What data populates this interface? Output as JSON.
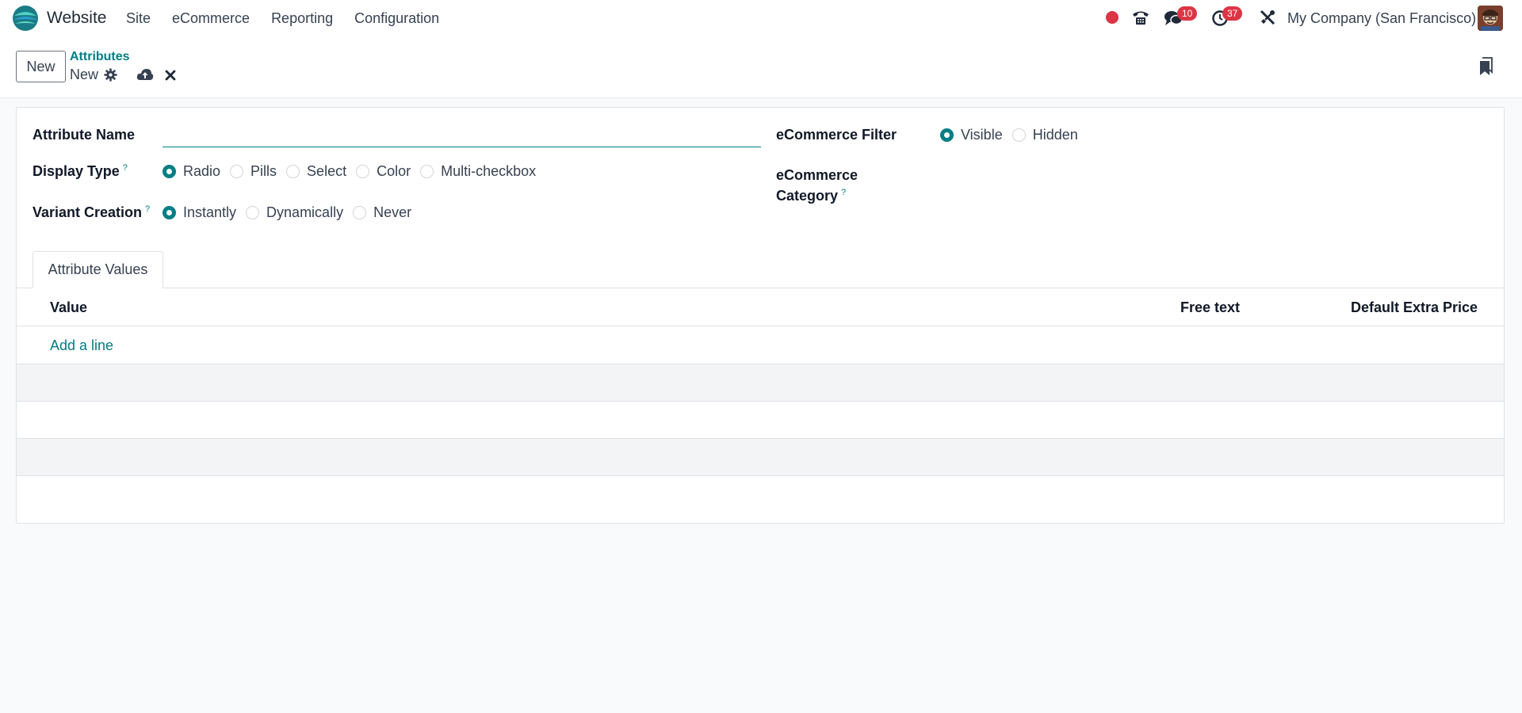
{
  "navbar": {
    "app_name": "Website",
    "menu": [
      "Site",
      "eCommerce",
      "Reporting",
      "Configuration"
    ],
    "messages_count": "10",
    "activities_count": "37",
    "company": "My Company (San Francisco)"
  },
  "control": {
    "new_button": "New",
    "breadcrumb_parent": "Attributes",
    "breadcrumb_current": "New"
  },
  "form": {
    "attribute_name_label": "Attribute Name",
    "attribute_name_value": "",
    "display_type_label": "Display Type",
    "display_type_help": "?",
    "display_type_options": [
      "Radio",
      "Pills",
      "Select",
      "Color",
      "Multi-checkbox"
    ],
    "display_type_selected": "Radio",
    "variant_creation_label": "Variant Creation",
    "variant_creation_help": "?",
    "variant_creation_options": [
      "Instantly",
      "Dynamically",
      "Never"
    ],
    "variant_creation_selected": "Instantly",
    "ecommerce_filter_label": "eCommerce Filter",
    "ecommerce_filter_options": [
      "Visible",
      "Hidden"
    ],
    "ecommerce_filter_selected": "Visible",
    "ecommerce_category_label_1": "eCommerce",
    "ecommerce_category_label_2": "Category",
    "ecommerce_category_help": "?"
  },
  "tabs": {
    "attribute_values": "Attribute Values"
  },
  "table": {
    "columns": [
      "Value",
      "Free text",
      "Default Extra Price"
    ],
    "add_line": "Add a line"
  },
  "colors": {
    "accent": "#017e84",
    "badge": "#dc3545",
    "record": "#dc3545"
  }
}
